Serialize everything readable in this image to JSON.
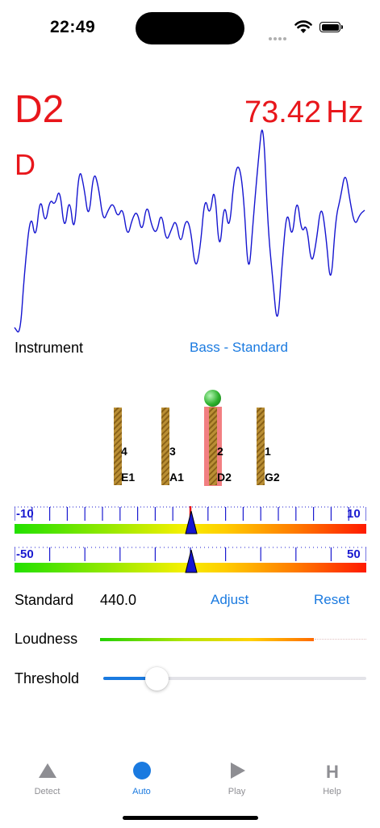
{
  "status": {
    "time": "22:49"
  },
  "detector": {
    "note_octave": "D2",
    "note_name": "D",
    "frequency": "73.42",
    "frequency_unit": "Hz"
  },
  "instrument": {
    "label": "Instrument",
    "value": "Bass - Standard"
  },
  "strings": [
    {
      "number": "4",
      "name": "E1",
      "active": false
    },
    {
      "number": "3",
      "name": "A1",
      "active": false
    },
    {
      "number": "2",
      "name": "D2",
      "active": true
    },
    {
      "number": "1",
      "name": "G2",
      "active": false
    }
  ],
  "scales": {
    "cents_scale": {
      "min_label": "-10",
      "max_label": "10",
      "value": 0
    },
    "fine_scale": {
      "min_label": "-50",
      "max_label": "50",
      "value": 0
    }
  },
  "standard": {
    "label": "Standard",
    "value": "440.0",
    "adjust_label": "Adjust",
    "reset_label": "Reset"
  },
  "loudness": {
    "label": "Loudness",
    "level": 0.82
  },
  "threshold": {
    "label": "Threshold",
    "level": 0.2
  },
  "tabs": [
    {
      "label": "Detect",
      "icon": "triangle-icon",
      "selected": false
    },
    {
      "label": "Auto",
      "icon": "circle-icon",
      "selected": true
    },
    {
      "label": "Play",
      "icon": "play-icon",
      "selected": false
    },
    {
      "label": "Help",
      "icon": "help-h-icon",
      "selected": false
    }
  ],
  "colors": {
    "note": "#e8161b",
    "accent": "#1a7ae0",
    "waveform": "#1515d0"
  }
}
